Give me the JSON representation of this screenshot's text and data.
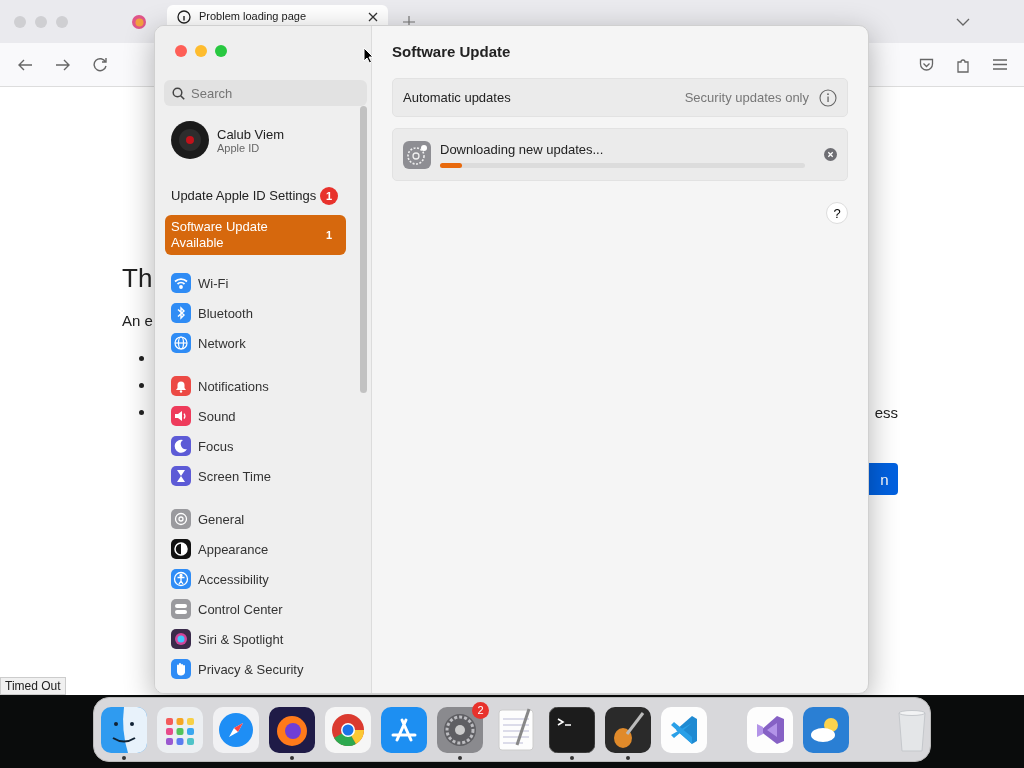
{
  "browser": {
    "tab": {
      "title": "Problem loading page"
    },
    "page": {
      "heading": "Th",
      "intro": "An e",
      "list_rows": [
        {
          "bullet": true
        },
        {
          "bullet": true
        },
        {
          "bullet": true,
          "trailing": "ess"
        }
      ],
      "button": {
        "label": "n"
      }
    },
    "status": "Timed Out"
  },
  "settings": {
    "search": {
      "placeholder": "Search"
    },
    "account": {
      "name": "Calub Viem",
      "subtitle": "Apple ID"
    },
    "notices": [
      {
        "label": "Update Apple ID Settings",
        "badge": "1",
        "selected": false
      },
      {
        "label": "Software Update Available",
        "badge": "1",
        "selected": true
      }
    ],
    "groups": [
      {
        "items": [
          {
            "label": "Wi-Fi",
            "kind": "wifi",
            "selected": false
          },
          {
            "label": "Bluetooth",
            "kind": "bluetooth",
            "selected": false
          },
          {
            "label": "Network",
            "kind": "network",
            "selected": false
          }
        ]
      },
      {
        "items": [
          {
            "label": "Notifications",
            "kind": "notifications",
            "selected": false
          },
          {
            "label": "Sound",
            "kind": "sound",
            "selected": false
          },
          {
            "label": "Focus",
            "kind": "focus",
            "selected": false
          },
          {
            "label": "Screen Time",
            "kind": "screentime",
            "selected": false
          }
        ]
      },
      {
        "items": [
          {
            "label": "General",
            "kind": "general",
            "selected": false
          },
          {
            "label": "Appearance",
            "kind": "appearance",
            "selected": false
          },
          {
            "label": "Accessibility",
            "kind": "accessibility",
            "selected": false
          },
          {
            "label": "Control Center",
            "kind": "controlcenter",
            "selected": false
          },
          {
            "label": "Siri & Spotlight",
            "kind": "siri",
            "selected": false
          },
          {
            "label": "Privacy & Security",
            "kind": "privacy",
            "selected": false
          }
        ]
      }
    ],
    "title": "Software Update",
    "automatic": {
      "label": "Automatic updates",
      "value": "Security updates only"
    },
    "download": {
      "status": "Downloading new updates...",
      "level": 0.06
    },
    "help": "?"
  },
  "dock": {
    "groups": [
      {
        "items": [
          {
            "kind": "finder",
            "running": true
          },
          {
            "kind": "launchpad",
            "running": false
          },
          {
            "kind": "safari",
            "running": false
          },
          {
            "kind": "firefox",
            "running": true
          },
          {
            "kind": "chrome",
            "running": false
          },
          {
            "kind": "appstore",
            "running": false
          },
          {
            "kind": "settings",
            "running": true,
            "badge": "2"
          },
          {
            "kind": "textedit",
            "running": false
          },
          {
            "kind": "terminal",
            "running": true
          },
          {
            "kind": "garageband",
            "running": true
          },
          {
            "kind": "vscode",
            "running": false
          }
        ]
      },
      {
        "items": [
          {
            "kind": "visualstudio",
            "running": false
          },
          {
            "kind": "weather",
            "running": false
          }
        ]
      },
      {
        "items": [
          {
            "kind": "trash",
            "running": false
          }
        ]
      }
    ]
  }
}
